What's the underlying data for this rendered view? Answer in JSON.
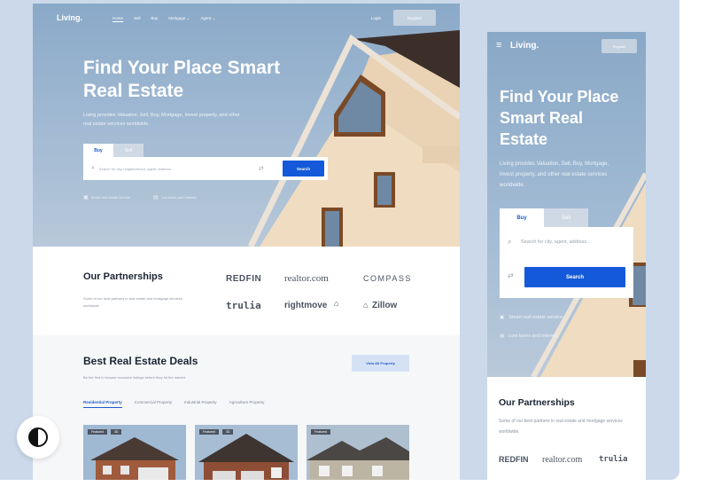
{
  "desktop": {
    "nav": {
      "logo": "Living.",
      "links": [
        "Home",
        "Sell",
        "Buy",
        "Mortgage ⌄",
        "Agent ⌄"
      ],
      "login": "Login",
      "register": "Register"
    },
    "hero": {
      "title": "Find Your Place Smart Real Estate",
      "description": "Living provides Valuation, Sell, Buy, Mortgage, Invest property, and other real estate services worldwide.",
      "tabs": [
        "Buy",
        "Sell"
      ],
      "search_placeholder": "Search for city, neighborhood, agent, address...",
      "search_button": "Search",
      "features": [
        "Smart real estate service",
        "Low taxes and interest"
      ]
    },
    "partnerships": {
      "title": "Our Partnerships",
      "description": "Some of our best partners in real estate and mortgage services worldwide.",
      "brands": [
        "REDFIN",
        "realtor.com",
        "COMPASS",
        "trulia",
        "rightmove",
        "Zillow"
      ]
    },
    "deals": {
      "title": "Best Real Estate Deals",
      "subtitle": "Be the first to browse exclusive listings before they hit the market.",
      "view_all": "View All Property",
      "tabs": [
        "Residential Property",
        "Commercial Property",
        "Industrial Property",
        "Agriculture Property"
      ],
      "cards": [
        {
          "badge": "Featured",
          "badge2": "3D"
        },
        {
          "badge": "Featured",
          "badge2": "3D"
        },
        {
          "badge": "Featured",
          "badge2": ""
        }
      ]
    }
  },
  "mobile": {
    "logo": "Living.",
    "register": "Register",
    "title": "Find Your Place Smart Real Estate",
    "description": "Living provides Valuation, Sell, Buy, Mortgage, Invest property, and other real estate services worldwide.",
    "tabs": [
      "Buy",
      "Sell"
    ],
    "search_placeholder": "Search for city, agent, address...",
    "search_button": "Search",
    "features": [
      "Smart real estate service",
      "Low taxes and interest"
    ],
    "partnerships_title": "Our Partnerships",
    "partnerships_description": "Some of our best partners in real estate and mortgage services worldwide.",
    "brands": [
      "REDFIN",
      "realtor.com",
      "trulia"
    ]
  },
  "icons": {
    "menu": "hamburger-icon",
    "search": "search-icon",
    "filter": "filter-icon",
    "theme": "contrast-icon"
  },
  "colors": {
    "accent": "#1459d9",
    "sky": "#9fb8d2"
  }
}
